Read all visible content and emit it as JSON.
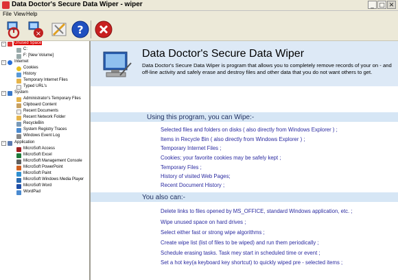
{
  "window": {
    "title": "Data Doctor's Secure Data Wiper - wiper"
  },
  "window_controls": {
    "minimize": "_",
    "maximize": "□",
    "close": "✕"
  },
  "menu": [
    "File",
    "View",
    "Help"
  ],
  "tree": {
    "unused_space": "Unused Space",
    "drive_c": "C:",
    "drive_f": "F: [New Volume]",
    "internet": "Internet",
    "cookies": "Cookies",
    "history": "History",
    "temp_internet": "Temporary Internet Files",
    "typed_urls": "Typed URL's",
    "system": "System",
    "admin_temp": "Administrator's Temporary Files",
    "clipboard": "Clipboard Content",
    "recent_docs": "Recent Documents",
    "recent_network": "Recent Network Folder",
    "recyclebin": "RecycleBin",
    "registry": "System Registry Traces",
    "event_log": "Windows Event Log",
    "application": "Application",
    "apps": [
      "MicroSoft Access",
      "MicroSoft Excel",
      "MicroSoft Management Console",
      "MicroSoft PowerPoint",
      "MicroSoft Paint",
      "MicroSoft Windows Media Player",
      "MicroSoft Word",
      "WordPad"
    ]
  },
  "banner": {
    "title": "Data Doctor's Secure Data Wiper",
    "description": "Data Doctor's Secure Data Wiper is program that allows you to completely remove records of your on - and off-line activity and safely erase and destroy files and other data that you do not want others to get."
  },
  "section1": {
    "title": "Using this program, you can Wipe:-",
    "items": [
      "Selected files and folders on disks ( also directly from Windows Explorer ) ;",
      "Items in Recycle Bin ( also directly from Windows Explorer ) ;",
      "Temporary Internet Files ;",
      "Cookies; your favorite cookies may be safely kept ;",
      "Temporary Files ;",
      "History of visited Web Pages;",
      "Recent Document History ;"
    ]
  },
  "section2": {
    "title": "You also can:-",
    "items": [
      "Delete links to files opened by MS_OFFICE, standard Windows application, etc. ;",
      "Wipe unused space on hard drives ;",
      "Select either fast or strong wipe algorithms ;",
      "Create wipe list (list of files to be wiped) and run them periodically ;",
      "Schedule erasing tasks. Task mey start in scheduled time or event ;",
      "Set a hot key(a keyboard key shortcut) to quickly wiped pre - selected items ;"
    ]
  },
  "colors": {
    "accent": "#2a2aa0",
    "banner_bg": "#dde9f6",
    "section_bar": "#d6e6f5",
    "selection": "#dd0000"
  }
}
